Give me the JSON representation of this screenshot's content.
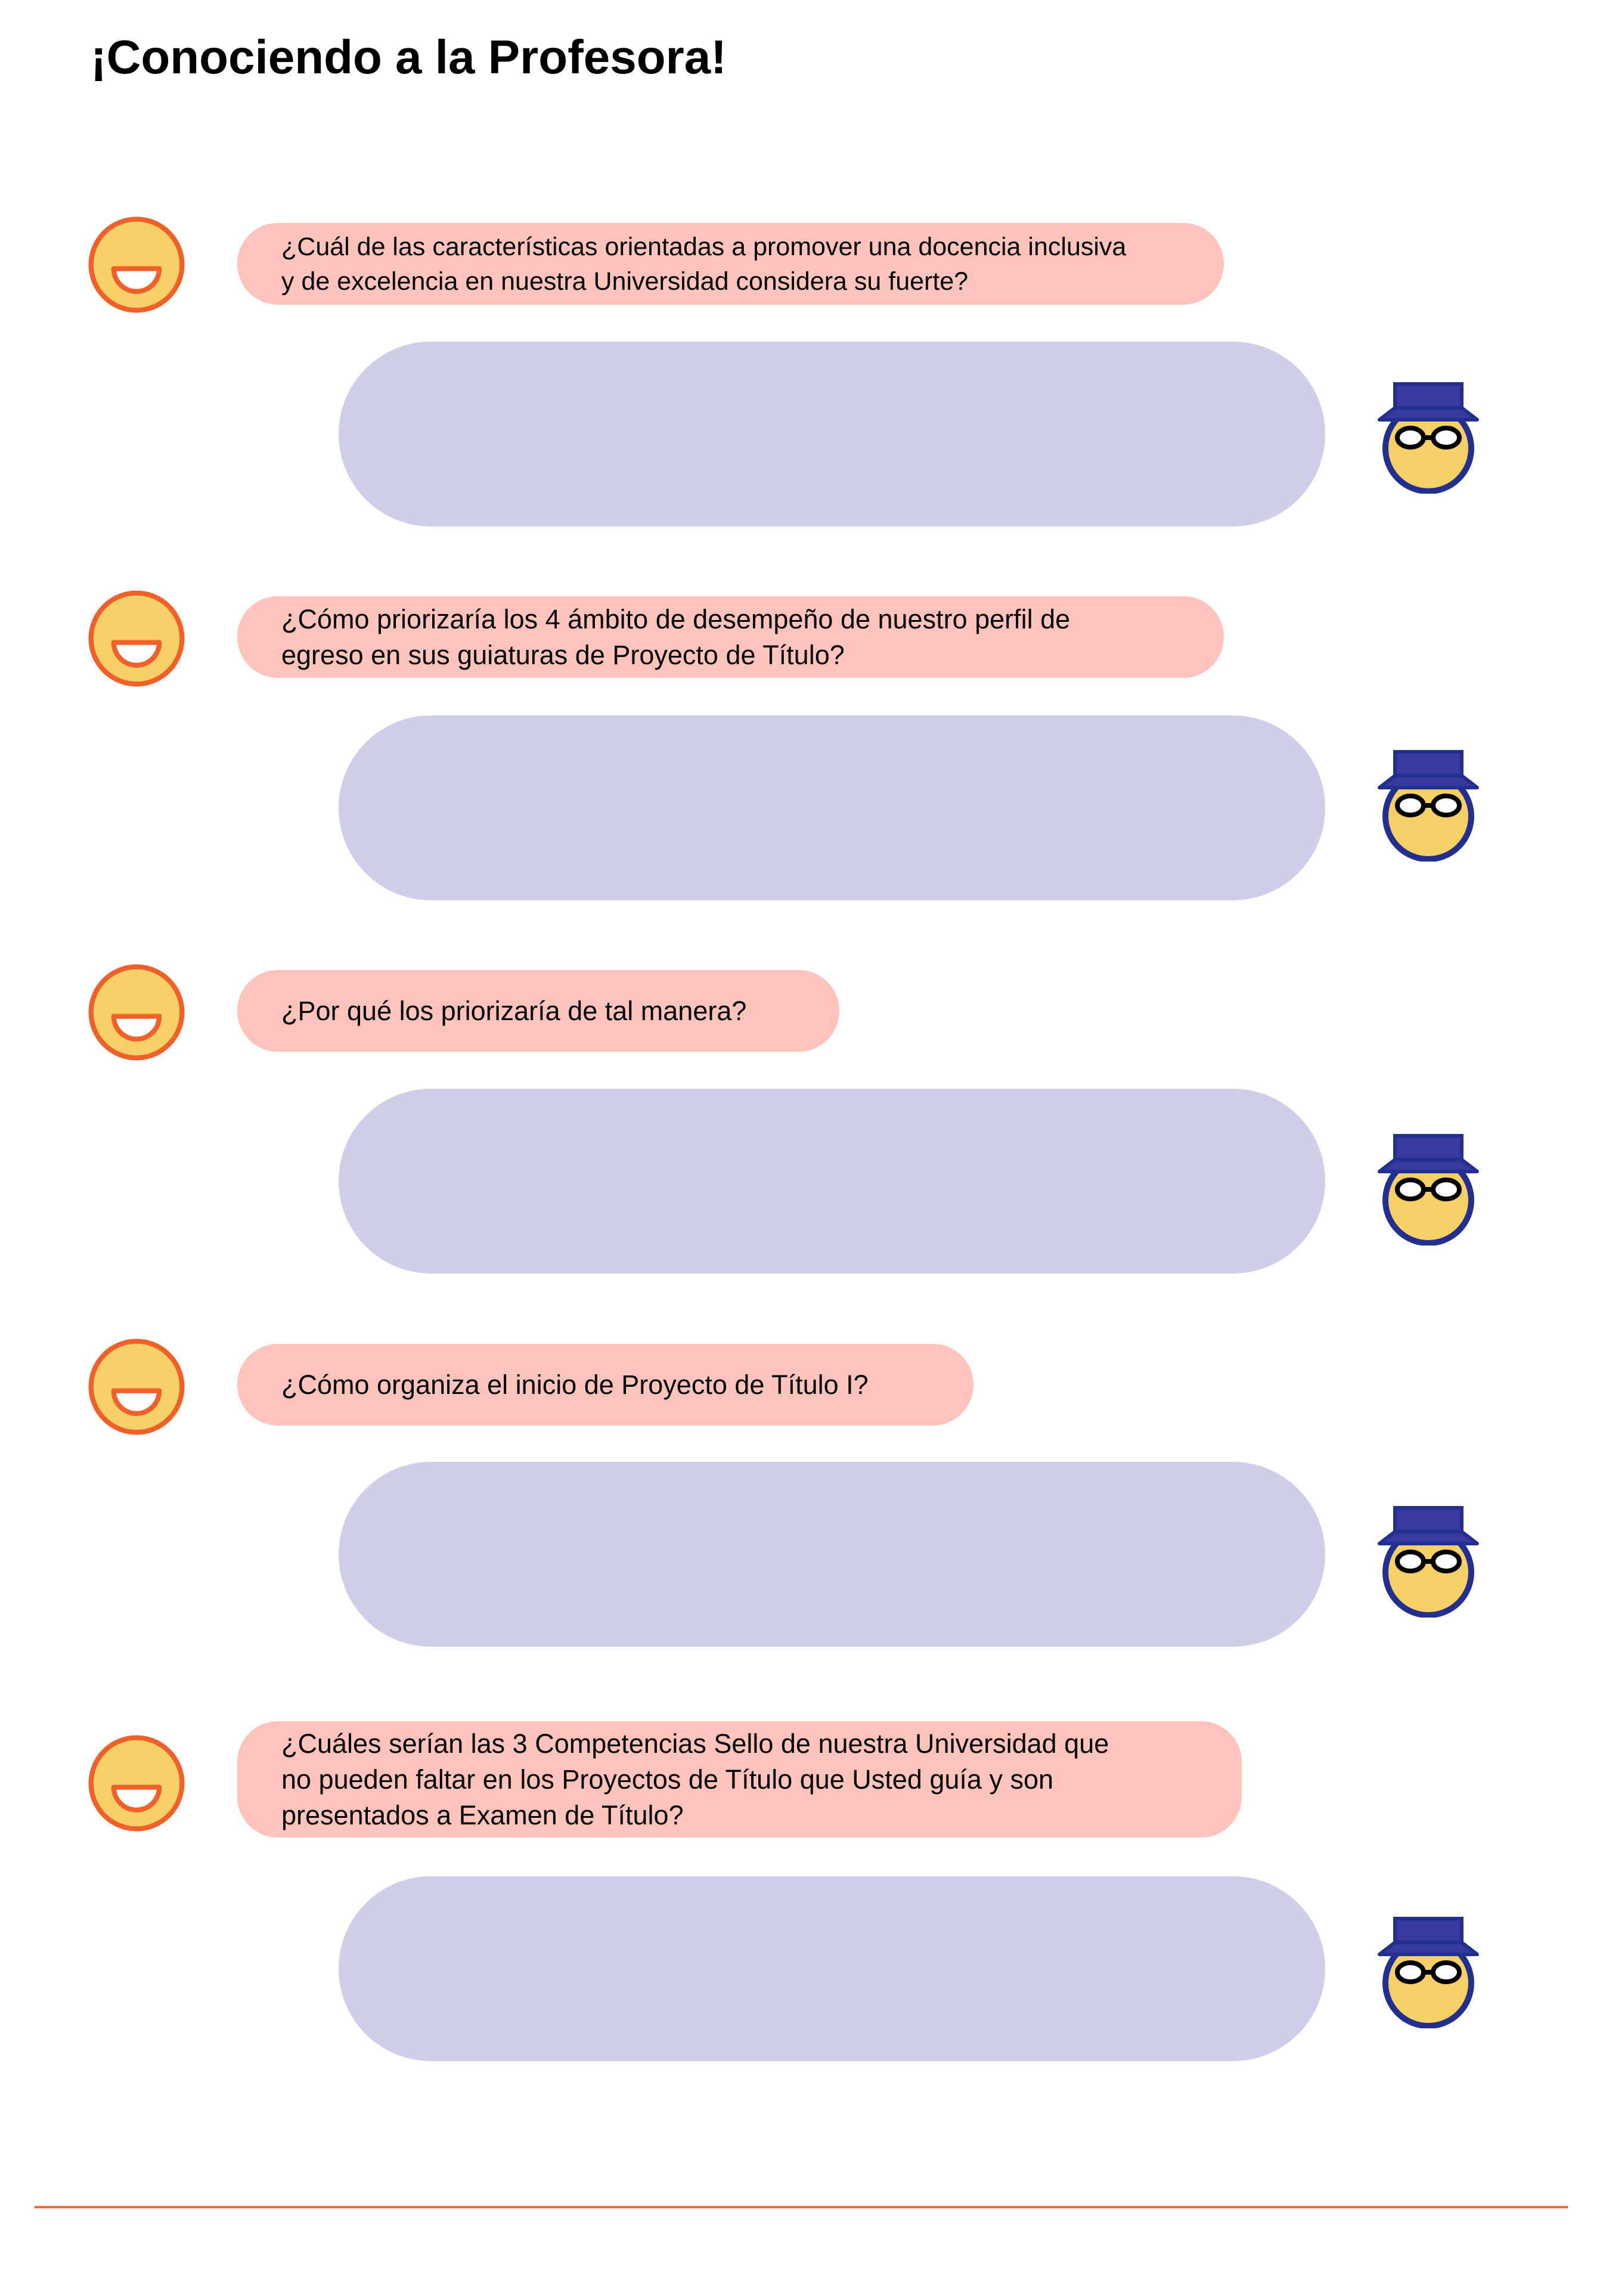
{
  "page": {
    "title": "¡Conociendo a la Profesora!"
  },
  "colors": {
    "question_bubble": "#fec4bb",
    "answer_bubble": "#d0cdea",
    "student_face": "#f6cf67",
    "student_outline": "#f0602b",
    "professor_face": "#f6cf67",
    "professor_hat": "#353a9c",
    "professor_outline": "#232f8f",
    "rule": "#f26a3a"
  },
  "icons": {
    "student": "smiley-face-icon",
    "professor": "professor-with-hat-and-glasses-icon"
  },
  "questions": [
    {
      "text": "¿Cuál de las características orientadas a promover una docencia inclusiva\ny de excelencia en nuestra Universidad considera su fuerte?",
      "answer": ""
    },
    {
      "text": "¿Cómo priorizaría los 4 ámbito de desempeño de nuestro perfil de\negreso en sus guiaturas de Proyecto de Título?",
      "answer": ""
    },
    {
      "text": "¿Por qué los priorizaría de tal manera?",
      "answer": ""
    },
    {
      "text": "¿Cómo organiza el inicio de Proyecto de Título I?",
      "answer": ""
    },
    {
      "text": "¿Cuáles serían las 3 Competencias Sello de nuestra Universidad que\nno pueden faltar en los Proyectos de Título que Usted guía y son\npresentados a Examen de Título?",
      "answer": ""
    }
  ]
}
